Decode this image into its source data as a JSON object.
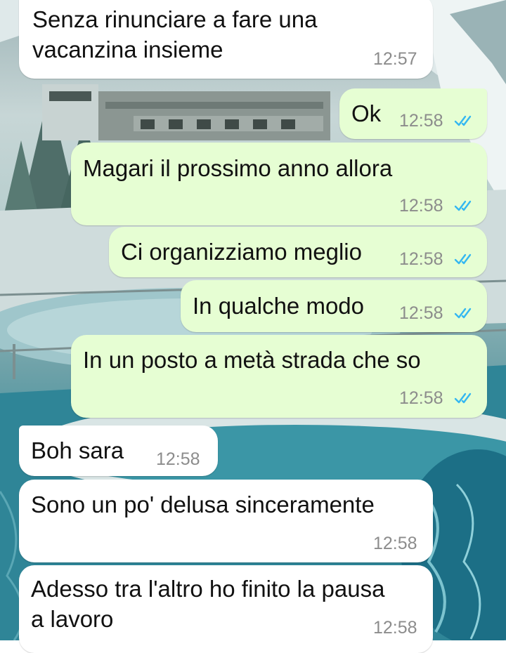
{
  "colors": {
    "incoming_bubble": "#ffffff",
    "outgoing_bubble": "#e6fed3",
    "read_ticks": "#34b7f1",
    "timestamp": "#8c8c8c"
  },
  "wallpaper": {
    "icon": "winter-lake-wallpaper"
  },
  "messages": [
    {
      "direction": "incoming",
      "lines": [
        "Senza rinunciare a fare una",
        "vacanzina insieme"
      ],
      "time": "12:57"
    },
    {
      "direction": "outgoing",
      "lines": [
        "Ok"
      ],
      "time": "12:58",
      "status": "read"
    },
    {
      "direction": "outgoing",
      "lines": [
        "Magari il prossimo anno allora"
      ],
      "time": "12:58",
      "status": "read"
    },
    {
      "direction": "outgoing",
      "lines": [
        "Ci organizziamo meglio"
      ],
      "time": "12:58",
      "status": "read"
    },
    {
      "direction": "outgoing",
      "lines": [
        "In qualche modo"
      ],
      "time": "12:58",
      "status": "read"
    },
    {
      "direction": "outgoing",
      "lines": [
        "In un posto a metà strada che so"
      ],
      "time": "12:58",
      "status": "read"
    },
    {
      "direction": "incoming",
      "lines": [
        "Boh sara"
      ],
      "time": "12:58"
    },
    {
      "direction": "incoming",
      "lines": [
        "Sono un po' delusa sinceramente"
      ],
      "time": "12:58"
    },
    {
      "direction": "incoming",
      "lines": [
        "Adesso tra l'altro ho finito la pausa",
        "a lavoro"
      ],
      "time": "12:58"
    }
  ]
}
